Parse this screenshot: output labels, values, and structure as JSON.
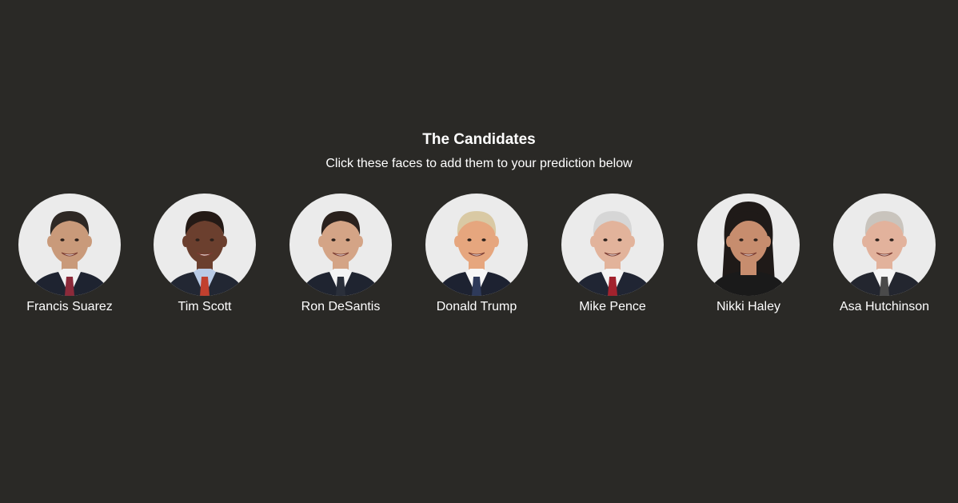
{
  "header": {
    "title": "The Candidates",
    "subtitle": "Click these faces to add them to your prediction below"
  },
  "colors": {
    "background": "#2a2926",
    "face_circle": "#ebebeb",
    "text": "#ffffff"
  },
  "candidates": [
    {
      "name": "Francis Suarez",
      "skin": "#c99a7a",
      "hair": "#2e2824",
      "suit": "#1e2330",
      "shirt": "#f2f2f2",
      "tie": "#8c2a3a"
    },
    {
      "name": "Tim Scott",
      "skin": "#6b3f2e",
      "hair": "#241a16",
      "suit": "#222733",
      "shirt": "#b9cbe6",
      "tie": "#c2402e"
    },
    {
      "name": "Ron DeSantis",
      "skin": "#d4a486",
      "hair": "#2a211d",
      "suit": "#1f2430",
      "shirt": "#f4f4f4",
      "tie": "#2a2f3a"
    },
    {
      "name": "Donald Trump",
      "skin": "#e6a67e",
      "hair": "#d9c9a4",
      "suit": "#1d2231",
      "shirt": "#f7f7f7",
      "tie": "#2e3a5a"
    },
    {
      "name": "Mike Pence",
      "skin": "#e2b39b",
      "hair": "#d6d6d6",
      "suit": "#202533",
      "shirt": "#f4f4f4",
      "tie": "#a2222d"
    },
    {
      "name": "Nikki Haley",
      "skin": "#c78d6e",
      "hair": "#1f1a18",
      "suit": "#1a1a1a",
      "shirt": "#1a1a1a",
      "tie": "#1a1a1a"
    },
    {
      "name": "Asa Hutchinson",
      "skin": "#e2b29c",
      "hair": "#c9c4bd",
      "suit": "#23262f",
      "shirt": "#f4f4f4",
      "tie": "#4a4a4a"
    }
  ]
}
